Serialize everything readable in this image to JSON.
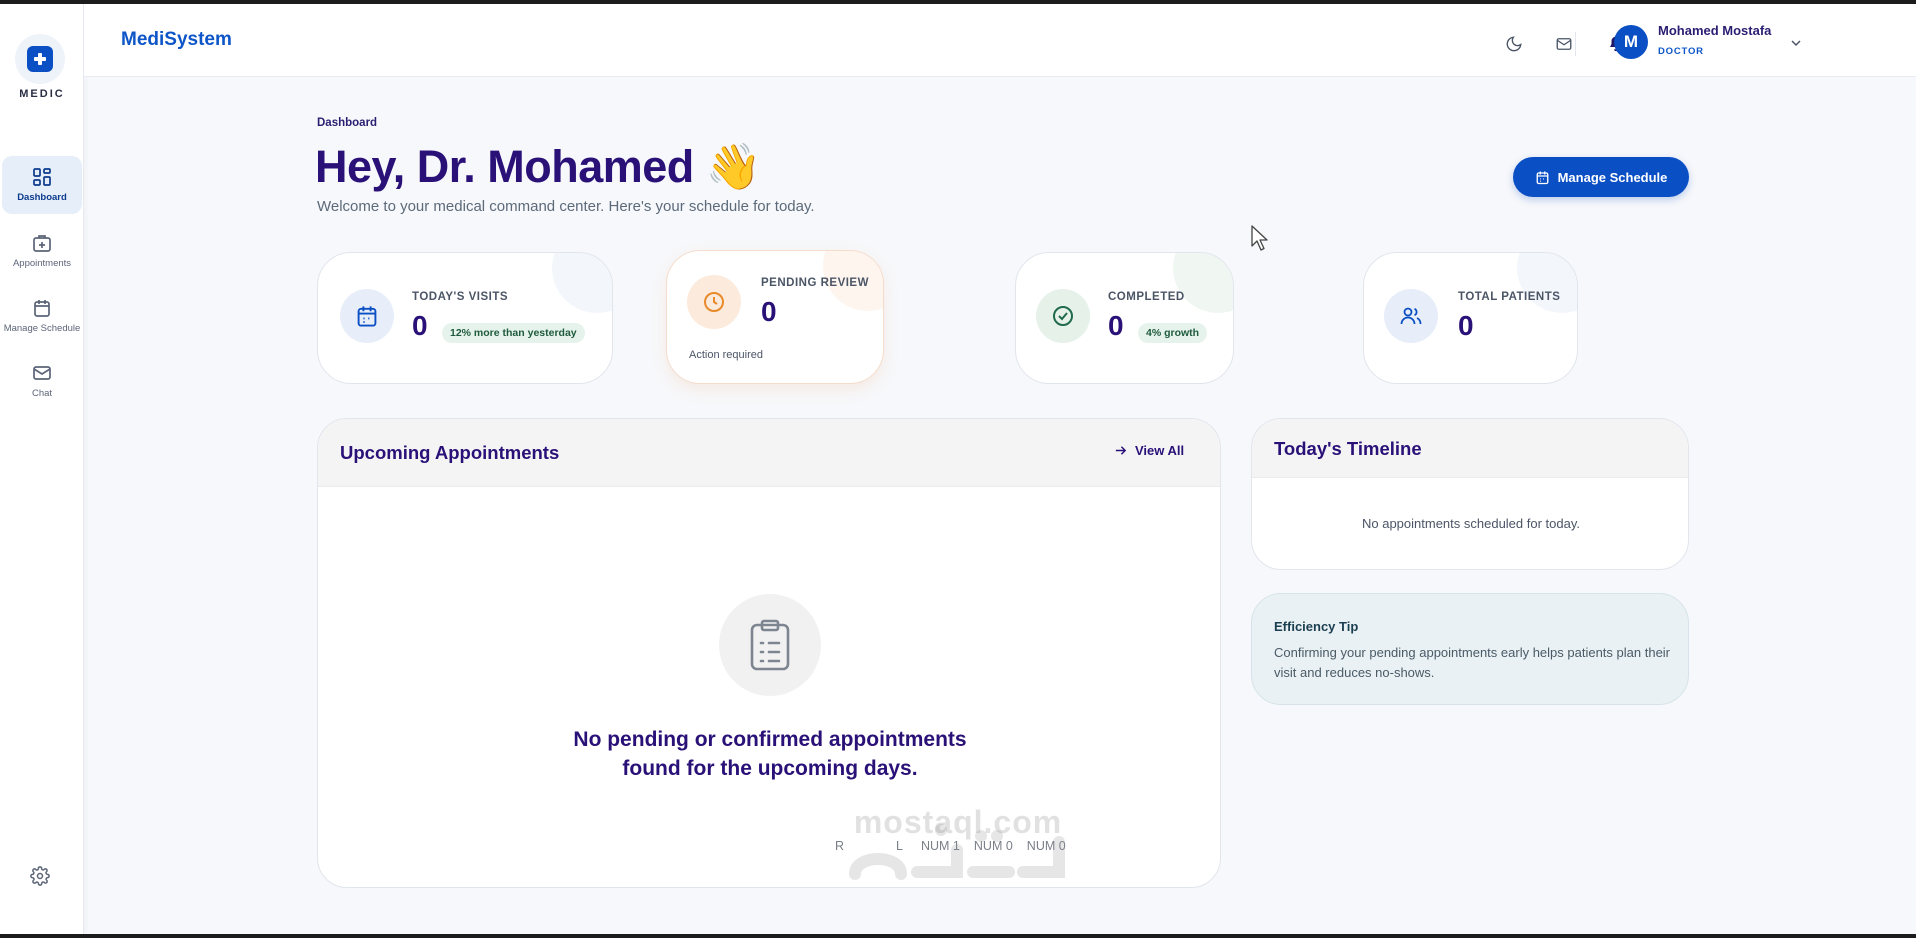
{
  "sidebar": {
    "logo_text": "MEDIC",
    "items": [
      {
        "label": "Dashboard",
        "icon": "dashboard-icon",
        "active": true
      },
      {
        "label": "Appointments",
        "icon": "briefcase-medical-icon",
        "active": false
      },
      {
        "label": "Manage Schedule",
        "icon": "calendar-icon",
        "active": false
      },
      {
        "label": "Chat",
        "icon": "mail-icon",
        "active": false
      }
    ],
    "settings_icon": "gear-icon"
  },
  "topbar": {
    "brand": "MediSystem",
    "icons": [
      "moon-icon",
      "mail-icon",
      "bell-icon"
    ],
    "user": {
      "initial": "M",
      "name": "Mohamed Mostafa",
      "role": "DOCTOR"
    }
  },
  "header": {
    "breadcrumb": "Dashboard",
    "greeting": "Hey, Dr. Mohamed 👋",
    "subtitle": "Welcome to your medical command center. Here's your schedule for today.",
    "manage_button": "Manage Schedule"
  },
  "stats": [
    {
      "label": "TODAY'S VISITS",
      "value": "0",
      "badge": "12% more than yesterday",
      "icon": "calendar-icon",
      "color": "#0b4fc4"
    },
    {
      "label": "PENDING REVIEW",
      "value": "0",
      "note": "Action required",
      "icon": "clock-icon",
      "color": "#e88a2c"
    },
    {
      "label": "COMPLETED",
      "value": "0",
      "badge": "4% growth",
      "icon": "check-circle-icon",
      "color": "#1f6b4a"
    },
    {
      "label": "TOTAL PATIENTS",
      "value": "0",
      "icon": "users-icon",
      "color": "#0b4fc4"
    }
  ],
  "appointments": {
    "title": "Upcoming Appointments",
    "view_all": "View All",
    "empty_line1": "No pending or confirmed appointments",
    "empty_line2": "found for the upcoming days.",
    "status_bar": [
      "R",
      "L",
      "NUM 1",
      "NUM 0",
      "NUM 0"
    ]
  },
  "timeline": {
    "title": "Today's Timeline",
    "empty": "No appointments scheduled for today."
  },
  "tip": {
    "title": "Efficiency Tip",
    "text": "Confirming your pending appointments early helps patients plan their visit and reduces no-shows."
  },
  "watermark": "mostaql.com",
  "colors": {
    "primary": "#0b4fc4",
    "heading": "#2a1178",
    "accent_orange": "#e88a2c",
    "success": "#1f6b4a"
  }
}
